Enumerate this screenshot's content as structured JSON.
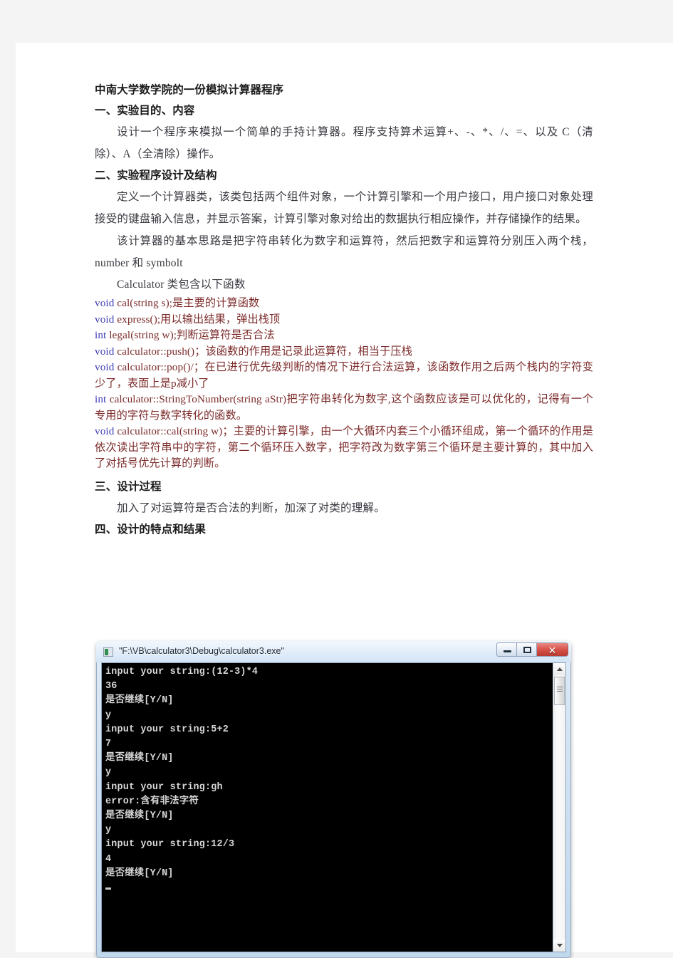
{
  "document": {
    "title": "中南大学数学院的一份模拟计算器程序",
    "sections": [
      {
        "heading": "一、实验目的、内容",
        "paragraphs": [
          "设计一个程序来模拟一个简单的手持计算器。程序支持算术运算+、-、*、/、=、以及 C（清除）、A（全清除）操作。"
        ]
      },
      {
        "heading": "二、实验程序设计及结构",
        "paragraphs": [
          "定义一个计算器类，该类包括两个组件对象，一个计算引擎和一个用户接口，用户接口对象处理接受的键盘输入信息，并显示答案，计算引擎对象对给出的数据执行相应操作，并存储操作的结果。",
          "该计算器的基本思路是把字符串转化为数字和运算符，然后把数字和运算符分别压入两个栈，number  和 symbolt",
          "Calculator 类包含以下函数"
        ]
      },
      {
        "heading": "三、设计过程",
        "paragraphs": [
          "加入了对运算符是否合法的判断，加深了对类的理解。"
        ]
      },
      {
        "heading": "四、设计的特点和结果",
        "paragraphs": []
      }
    ],
    "code_lines": [
      {
        "keyword": "void",
        "rest": " cal(string  s);是主要的计算函数"
      },
      {
        "keyword": "void",
        "rest": " express();用以输出结果，弹出栈顶"
      },
      {
        "keyword": "int",
        "rest": " legal(string  w);判断运算符是否合法"
      },
      {
        "keyword": "void",
        "rest": " calculator::push()；该函数的作用是记录此运算符，相当于压栈"
      },
      {
        "keyword": "void",
        "rest": " calculator::pop()/；在已进行优先级判断的情况下进行合法运算，该函数作用之后两个栈内的字符变少了，表面上是p减小了"
      },
      {
        "keyword": "int",
        "rest": " calculator::StringToNumber(string  aStr)把字符串转化为数字,这个函数应该是可以优化的，记得有一个专用的字符与数字转化的函数。"
      },
      {
        "keyword": "void",
        "rest": " calculator::cal(string  w)；主要的计算引擎，由一个大循环内套三个小循环组成，第一个循环的作用是依次读出字符串中的字符，第二个循环压入数字，把字符改为数字第三个循环是主要计算的，其中加入了对括号优先计算的判断。"
      }
    ],
    "colors": {
      "keyword": "#4040b8",
      "code_text": "#7d2b2b",
      "body_text": "#3a3a42",
      "heading_text": "#1b1b1b"
    }
  },
  "console_window": {
    "title": "\"F:\\VB\\calculator3\\Debug\\calculator3.exe\"",
    "icon": "console-app-icon",
    "buttons": {
      "minimize": "–",
      "maximize": "□",
      "close": "✕"
    },
    "output": "input your string:(12-3)*4\n36\n是否继续[Y/N]\ny\ninput your string:5+2\n7\n是否继续[Y/N]\ny\ninput your string:gh\nerror:含有非法字符\n是否继续[Y/N]\ny\ninput your string:12/3\n4\n是否继续[Y/N]\n"
  }
}
